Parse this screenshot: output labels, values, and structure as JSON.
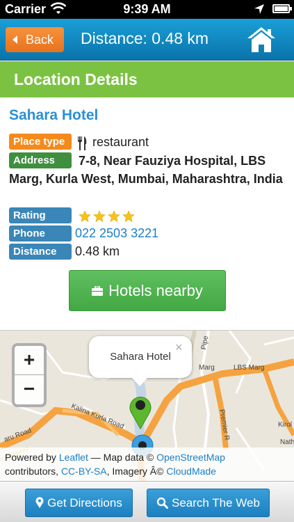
{
  "status_bar": {
    "carrier": "Carrier",
    "time": "9:39 AM"
  },
  "nav": {
    "back_label": "Back",
    "title": "Distance: 0.48 km",
    "home_icon": "home-icon"
  },
  "section": {
    "title": "Location Details"
  },
  "hotel": {
    "name": "Sahara Hotel",
    "place_type_label": "Place type",
    "place_type_value": "restaurant",
    "address_label": "Address",
    "address_value": "7-8, Near Fauziya Hospital, LBS Marg, Kurla West, Mumbai, Maharashtra, India",
    "rating_label": "Rating",
    "rating_value": 4,
    "rating_max": 4,
    "phone_label": "Phone",
    "phone_value": "022 2503 3221",
    "distance_label": "Distance",
    "distance_value": "0.48 km"
  },
  "hotels_nearby_button": "Hotels nearby",
  "map": {
    "zoom_in": "+",
    "zoom_out": "−",
    "popup_title": "Sahara Hotel",
    "popup_close": "×",
    "labels": [
      "LBS Marg",
      "Marg",
      "Kalina Kurla Road",
      "Premier R",
      "Kirol",
      "Nath",
      "aru Road",
      "Pipe"
    ],
    "attribution": {
      "powered_by": "Powered by",
      "leaflet": "Leaflet",
      "map_data": "— Map data ©",
      "osm": "OpenStreetMap",
      "contributors": "contributors,",
      "license": "CC-BY-SA",
      "imagery": ", Imagery Â©",
      "cloudmade": "CloudMade"
    }
  },
  "toolbar": {
    "directions_label": "Get Directions",
    "search_label": "Search The Web"
  },
  "colors": {
    "nav": "#0a73aa",
    "section": "#7cc242",
    "orange": "#f48a1c",
    "link": "#1b7fc8"
  }
}
